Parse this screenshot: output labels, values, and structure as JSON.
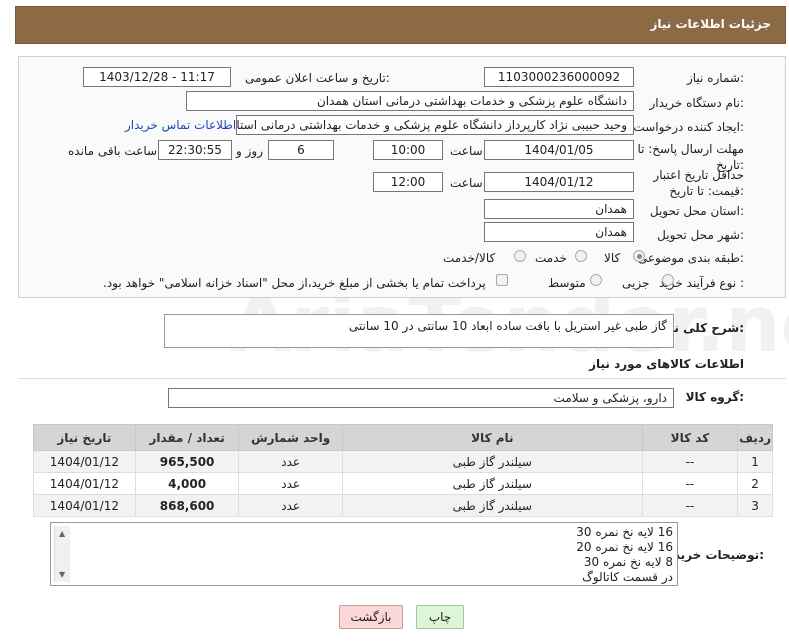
{
  "header": {
    "title": "جزئیات اطلاعات نیاز"
  },
  "form": {
    "need_number_label": "شماره نیاز:",
    "need_number": "1103000236000092",
    "announce_label": "تاریخ و ساعت اعلان عمومی:",
    "announce_value": "1403/12/28 - 11:17",
    "buyer_org_label": "نام دستگاه خریدار:",
    "buyer_org": "دانشگاه علوم پزشکی و خدمات بهداشتی درمانی استان همدان",
    "requester_label": "ایجاد کننده درخواست:",
    "requester": "وحید حبیبی نژاد کارپرداز دانشگاه علوم پزشکی و خدمات بهداشتی درمانی استا",
    "contact_link": "اطلاعات تماس خریدار",
    "reply_deadline_label": "مهلت ارسال پاسخ: تا تاریخ:",
    "reply_date": "1404/01/05",
    "time_label": "ساعت",
    "reply_time": "10:00",
    "days_value": "6",
    "days_label": "روز و",
    "remaining_time": "22:30:55",
    "remaining_label": "ساعت باقی مانده",
    "price_validity_label": "حداقل تاریخ اعتبار قیمت: تا تاریخ:",
    "price_date": "1404/01/12",
    "price_time": "12:00",
    "province_label": "استان محل تحویل:",
    "province": "همدان",
    "city_label": "شهر محل تحویل:",
    "city": "همدان",
    "category_label": "طبقه بندی موضوعی:",
    "category_options": [
      "کالا",
      "خدمت",
      "کالا/خدمت"
    ],
    "process_label": "نوع فرآیند خرید :",
    "process_options": [
      "جزیی",
      "متوسط"
    ],
    "payment_note": "پرداخت تمام یا بخشی از مبلغ خرید،از محل \"اسناد خزانه اسلامی\" خواهد بود."
  },
  "description": {
    "label": "شرح کلی نیاز:",
    "value": "گاز طبی غیر استریل با بافت ساده ابعاد 10 سانتی در 10 سانتی"
  },
  "goods": {
    "section_title": "اطلاعات کالاهای مورد نیاز",
    "group_label": "گروه کالا:",
    "group_value": "دارو، پزشکی و سلامت",
    "columns": [
      "ردیف",
      "کد کالا",
      "نام کالا",
      "واحد شمارش",
      "تعداد / مقدار",
      "تاریخ نیاز"
    ],
    "rows": [
      {
        "row": "1",
        "code": "--",
        "name": "سیلندر گاز طبی",
        "unit": "عدد",
        "qty": "965,500",
        "date": "1404/01/12"
      },
      {
        "row": "2",
        "code": "--",
        "name": "سیلندر گاز طبی",
        "unit": "عدد",
        "qty": "4,000",
        "date": "1404/01/12"
      },
      {
        "row": "3",
        "code": "--",
        "name": "سیلندر گاز طبی",
        "unit": "عدد",
        "qty": "868,600",
        "date": "1404/01/12"
      }
    ]
  },
  "notes": {
    "label": "توضیحات خریدار:",
    "lines": [
      "16 لایه نخ نمره 30",
      "16 لایه نخ نمره 20",
      "8 لایه نخ نمره 30",
      "در قسمت کاتالوگ"
    ]
  },
  "buttons": {
    "back": "بازگشت",
    "print": "چاپ"
  },
  "watermark": "AriaTender.net"
}
